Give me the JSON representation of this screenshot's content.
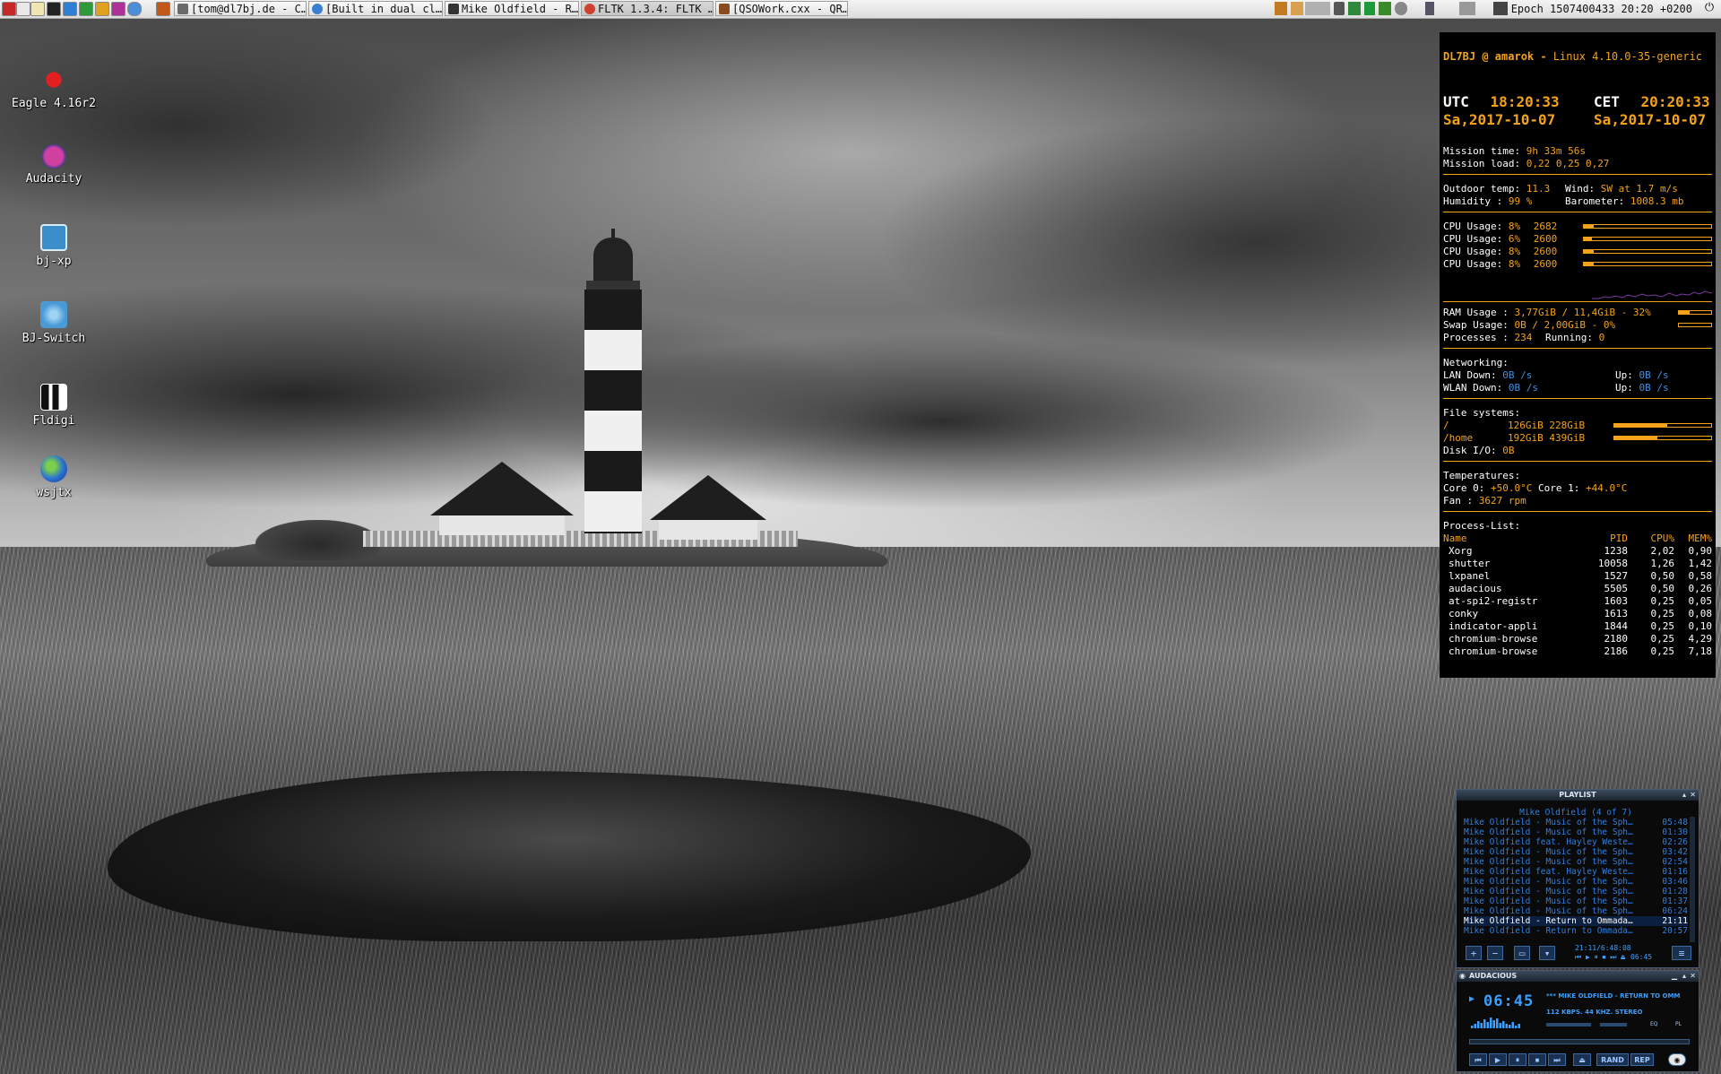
{
  "taskbar": {
    "launchers": [
      "menu-icon",
      "file-manager-icon",
      "notes-icon",
      "terminal-icon",
      "browser-icon",
      "spreadsheet-icon",
      "text-editor-icon",
      "presentation-icon",
      "chromium-icon"
    ],
    "tasks": [
      {
        "label": "[tom@dl7bj.de - C…",
        "icon": "mail-icon"
      },
      {
        "label": "[Built in dual cl…",
        "icon": "chromium-icon"
      },
      {
        "label": "Mike Oldfield - R…",
        "icon": "media-icon"
      },
      {
        "label": "FLTK 1.3.4: FLTK …",
        "icon": "chromium-icon"
      },
      {
        "label": "[QSOWork.cxx - QR…",
        "icon": "editor-icon"
      }
    ],
    "clock": "Epoch 1507400433 20:20 +0200"
  },
  "desktop": {
    "icons": [
      {
        "label": "Eagle 4.16r2",
        "icon": "eagle-icon",
        "color": "#d21010"
      },
      {
        "label": "Audacity",
        "icon": "audacity-icon",
        "color": "#c0309a"
      },
      {
        "label": "bj-xp",
        "icon": "waveform-icon",
        "color": "#3b8ec9"
      },
      {
        "label": "BJ-Switch",
        "icon": "antenna-icon",
        "color": "#57a6d8"
      },
      {
        "label": "Fldigi",
        "icon": "fldigi-icon",
        "color": "#ffffff"
      },
      {
        "label": "wsjtx",
        "icon": "globe-icon",
        "color": "#2a6fd6"
      }
    ]
  },
  "conky": {
    "host": "DL7BJ @ amarok -",
    "kernel": "Linux 4.10.0-35-generic",
    "utc_label": "UTC",
    "utc_time": "18:20:33",
    "utc_date": "Sa,2017-10-07",
    "cet_label": "CET",
    "cet_time": "20:20:33",
    "cet_date": "Sa,2017-10-07",
    "mission_time_label": "Mission time:",
    "mission_time": "9h 33m 56s",
    "mission_load_label": "Mission load:",
    "mission_load": "0,22 0,25 0,27",
    "outdoor_label": "Outdoor temp:",
    "outdoor": "11.3",
    "wind_label": "Wind:",
    "wind": "SW at 1.7  m/s",
    "humidity_label": "Humidity    :",
    "humidity": "99 %",
    "baro_label": "Barometer:",
    "baro": "1008.3 mb",
    "cpus": [
      {
        "label": "CPU Usage:",
        "pct": "8%",
        "mhz": "2682",
        "fill": 0.08
      },
      {
        "label": "CPU Usage:",
        "pct": "6%",
        "mhz": "2600",
        "fill": 0.06
      },
      {
        "label": "CPU Usage:",
        "pct": "8%",
        "mhz": "2600",
        "fill": 0.08
      },
      {
        "label": "CPU Usage:",
        "pct": "8%",
        "mhz": "2600",
        "fill": 0.08
      }
    ],
    "ram_label": "RAM Usage :",
    "ram": "3,77GiB  / 11,4GiB  - 32%",
    "ram_fill": 0.32,
    "swap_label": "Swap Usage:",
    "swap": "0B    / 2,00GiB - 0%",
    "swap_fill": 0.0,
    "proc_label": "Processes :",
    "procs": "234",
    "running_label": "Running:",
    "running": "0",
    "net_title": "Networking:",
    "lan_label": " LAN  Down:",
    "lan_down": "0B  /s",
    "lan_up_label": "Up:",
    "lan_up": "0B  /s",
    "wlan_label": " WLAN Down:",
    "wlan_down": "0B  /s",
    "wlan_up_label": "Up:",
    "wlan_up": "0B  /s",
    "fs_title": "File systems:",
    "fs": [
      {
        "mount": " /",
        "used": "126GiB",
        "size": "228GiB",
        "fill": 0.55
      },
      {
        "mount": " /home",
        "used": "192GiB",
        "size": "439GiB",
        "fill": 0.44
      }
    ],
    "diskio_label": "Disk I/O:",
    "diskio": "0B",
    "temp_title": "Temperatures:",
    "core0_label": "Core 0:",
    "core0": "+50.0°C",
    "core1_label": "Core 1:",
    "core1": "+44.0°C",
    "fan_label": "Fan   :",
    "fan": "3627 rpm",
    "proc_title": "Process-List:",
    "proc_headers": {
      "name": "Name",
      "pid": "PID",
      "cpu": "CPU%",
      "mem": "MEM%"
    },
    "processes": [
      {
        "name": "Xorg",
        "pid": "1238",
        "cpu": "2,02",
        "mem": "0,90"
      },
      {
        "name": "shutter",
        "pid": "10058",
        "cpu": "1,26",
        "mem": "1,42"
      },
      {
        "name": "lxpanel",
        "pid": "1527",
        "cpu": "0,50",
        "mem": "0,58"
      },
      {
        "name": "audacious",
        "pid": "5505",
        "cpu": "0,50",
        "mem": "0,26"
      },
      {
        "name": "at-spi2-registr",
        "pid": "1603",
        "cpu": "0,25",
        "mem": "0,05"
      },
      {
        "name": "conky",
        "pid": "1613",
        "cpu": "0,25",
        "mem": "0,08"
      },
      {
        "name": "indicator-appli",
        "pid": "1844",
        "cpu": "0,25",
        "mem": "0,10"
      },
      {
        "name": "chromium-browse",
        "pid": "2180",
        "cpu": "0,25",
        "mem": "4,29"
      },
      {
        "name": "chromium-browse",
        "pid": "2186",
        "cpu": "0,25",
        "mem": "7,18"
      }
    ]
  },
  "playlist": {
    "title": "PLAYLIST",
    "header": "Mike Oldfield (4 of 7)",
    "items": [
      {
        "title": "Mike Oldfield - Music of the Sph…",
        "dur": "05:48"
      },
      {
        "title": "Mike Oldfield - Music of the Sph…",
        "dur": "01:30"
      },
      {
        "title": "Mike Oldfield feat. Hayley Weste…",
        "dur": "02:26"
      },
      {
        "title": "Mike Oldfield - Music of the Sph…",
        "dur": "03:42"
      },
      {
        "title": "Mike Oldfield - Music of the Sph…",
        "dur": "02:54"
      },
      {
        "title": "Mike Oldfield feat. Hayley Weste…",
        "dur": "01:16"
      },
      {
        "title": "Mike Oldfield - Music of the Sph…",
        "dur": "03:46"
      },
      {
        "title": "Mike Oldfield - Music of the Sph…",
        "dur": "01:28"
      },
      {
        "title": "Mike Oldfield - Music of the Sph…",
        "dur": "01:37"
      },
      {
        "title": "Mike Oldfield - Music of the Sph…",
        "dur": "06:24"
      },
      {
        "title": "Mike Oldfield - Return to Ommada…",
        "dur": "21:11"
      },
      {
        "title": "Mike Oldfield - Return to Ommada…",
        "dur": "20:57"
      }
    ],
    "current_index": 10,
    "total_time": "21:11/6:48:08",
    "elapsed": "06:45"
  },
  "audacious": {
    "title": "AUDACIOUS",
    "time": "06:45",
    "song": "*** MIKE OLDFIELD - RETURN TO OMM",
    "info": "112 KBPS. 44 KHZ. STEREO",
    "eq_label": "EQ",
    "pl_label": "PL",
    "rand_label": "RAND",
    "rep_label": "REP"
  }
}
